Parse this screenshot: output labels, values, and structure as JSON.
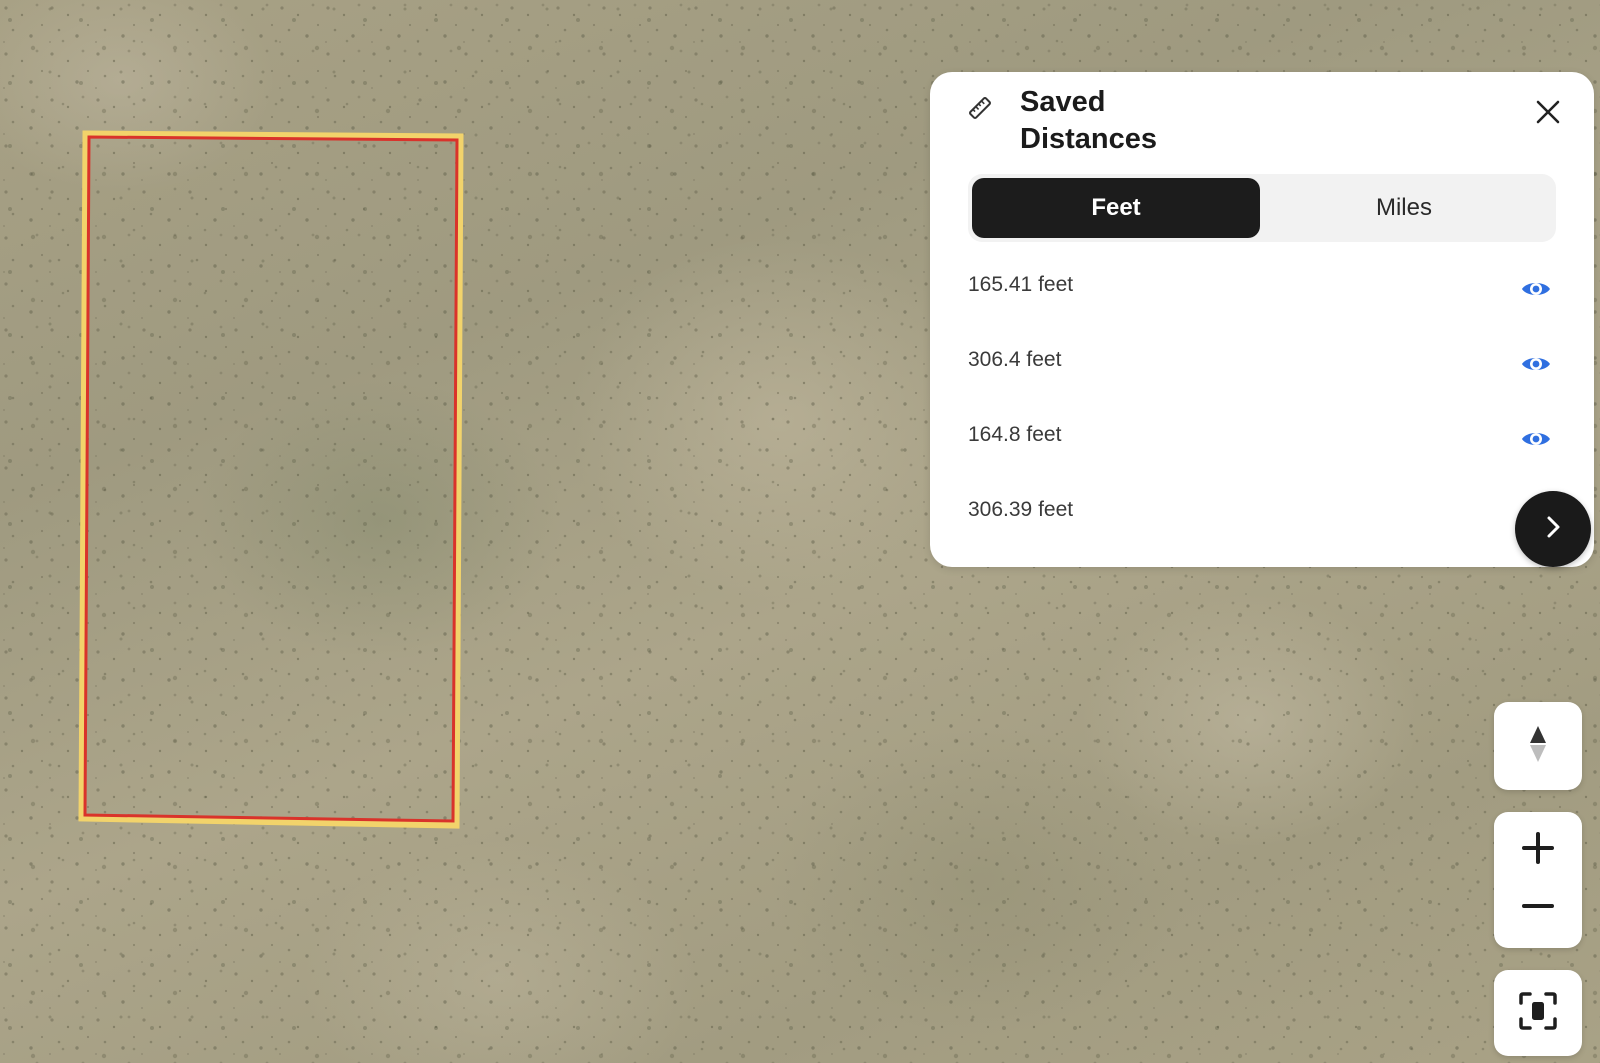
{
  "panel": {
    "title": "Saved Distances",
    "icon": "ruler-icon",
    "close_icon": "close-icon"
  },
  "units": {
    "options": [
      "Feet",
      "Miles"
    ],
    "selected": "Feet"
  },
  "distances": [
    {
      "label": "165.41 feet",
      "icon": "eye-icon"
    },
    {
      "label": "306.4 feet",
      "icon": "eye-icon"
    },
    {
      "label": "164.8 feet",
      "icon": "eye-icon"
    },
    {
      "label": "306.39 feet",
      "icon": "eye-icon"
    }
  ],
  "controls": {
    "next_icon": "chevron-right-icon",
    "compass_icon": "compass-icon",
    "zoom_in_icon": "plus-icon",
    "zoom_out_icon": "minus-icon",
    "fit_icon": "fit-bounds-icon"
  },
  "colors": {
    "accent_dark": "#1c1c1c",
    "eye_blue": "#2f6fe0",
    "parcel_red": "#d9332b",
    "parcel_yellow": "#f2d36b"
  }
}
